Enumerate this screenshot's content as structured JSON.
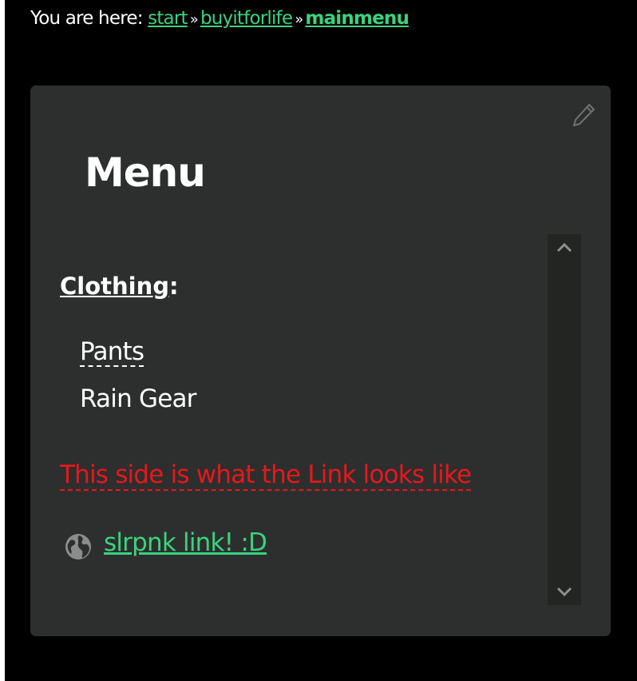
{
  "breadcrumb": {
    "prefix": "You are here:",
    "separator": "»",
    "crumbs": [
      "start",
      "buyitforlife",
      "mainmenu"
    ]
  },
  "panel": {
    "title": "Menu",
    "edit_icon": "pencil-icon",
    "category": {
      "label": "Clothing",
      "suffix": ":"
    },
    "items": [
      "Pants",
      "Rain Gear"
    ],
    "red_link": "This side is what the Link looks like",
    "external_link": {
      "icon": "globe-icon",
      "label": "slrpnk link! :D"
    },
    "scrollbar": {
      "up_icon": "chevron-up-icon",
      "down_icon": "chevron-down-icon"
    }
  },
  "colors": {
    "background": "#000000",
    "panel": "#2d2f2e",
    "link": "#3bd27e",
    "missing_link": "#e8171c",
    "text": "#ffffff"
  }
}
